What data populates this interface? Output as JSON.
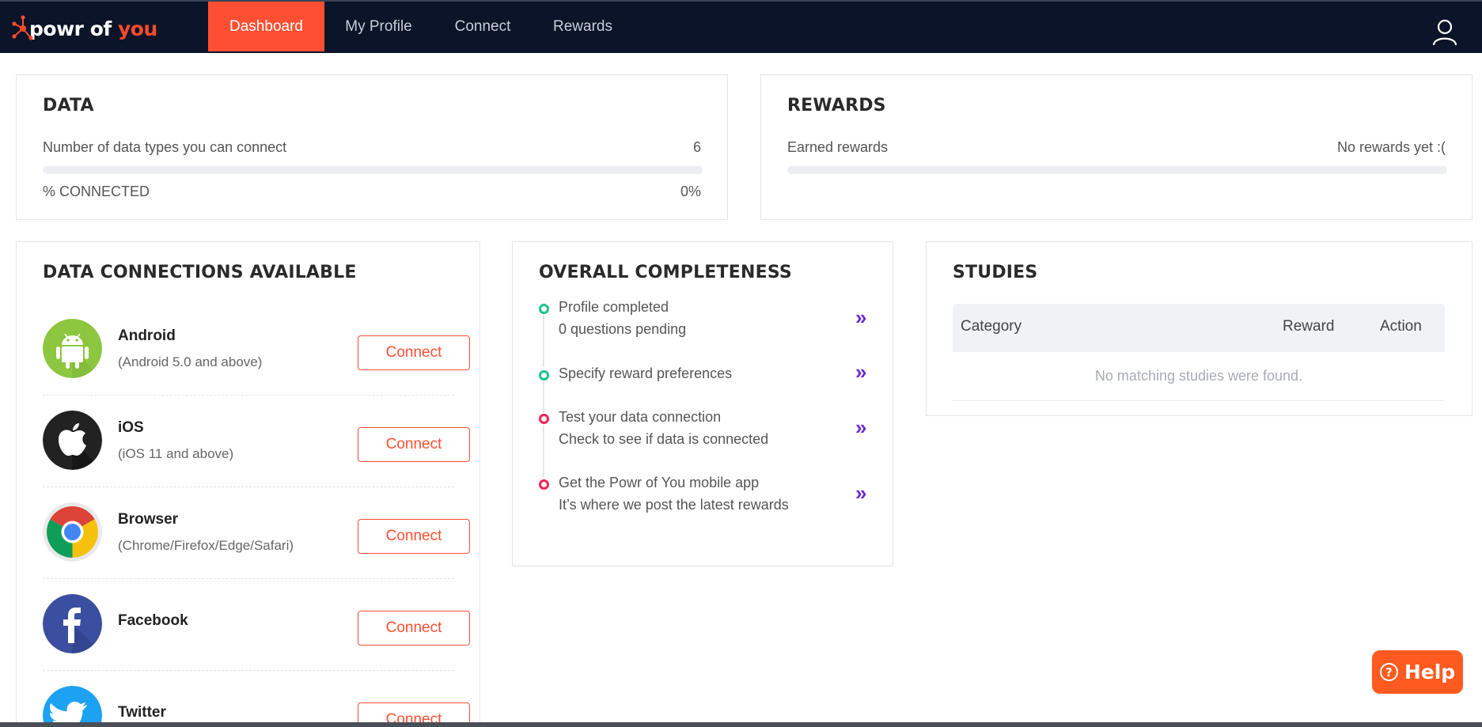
{
  "app": {
    "logo_part1": "powr of",
    "logo_part2": "you"
  },
  "nav": {
    "items": [
      {
        "label": "Dashboard",
        "active": true
      },
      {
        "label": "My Profile"
      },
      {
        "label": "Connect"
      },
      {
        "label": "Rewards"
      }
    ],
    "user_icon": "user-icon"
  },
  "data_card": {
    "title": "DATA",
    "types_label": "Number of data types you can connect",
    "types_value": "6",
    "connected_label": "% CONNECTED",
    "connected_value": "0%",
    "connected_fraction": 0
  },
  "rewards_card": {
    "title": "REWARDS",
    "earned_label": "Earned rewards",
    "earned_value": "No rewards yet :(",
    "earned_fraction": 0
  },
  "connections": {
    "title": "DATA CONNECTIONS AVAILABLE",
    "items": [
      {
        "name": "Android",
        "sub": "(Android 5.0 and above)",
        "button": "Connect",
        "icon": "android-icon"
      },
      {
        "name": "iOS",
        "sub": "(iOS 11 and above)",
        "button": "Connect",
        "icon": "apple-icon"
      },
      {
        "name": "Browser",
        "sub": "(Chrome/Firefox/Edge/Safari)",
        "button": "Connect",
        "icon": "chrome-icon"
      },
      {
        "name": "Facebook",
        "sub": "",
        "button": "Connect",
        "icon": "facebook-icon"
      },
      {
        "name": "Twitter",
        "sub": "",
        "button": "Connect",
        "icon": "twitter-icon"
      }
    ]
  },
  "completeness": {
    "title": "OVERALL COMPLETENESS",
    "steps": [
      {
        "line1": "Profile completed",
        "line2": "0 questions pending",
        "status": "done"
      },
      {
        "line1": "Specify reward preferences",
        "line2": "",
        "status": "done"
      },
      {
        "line1": "Test your data connection",
        "line2": "Check to see if data is connected",
        "status": "todo"
      },
      {
        "line1": "Get the Powr of You mobile app",
        "line2": "It’s where we post the latest rewards",
        "status": "todo"
      }
    ],
    "arrow": "»"
  },
  "studies": {
    "title": "STUDIES",
    "columns": [
      "Category",
      "Reward",
      "Action"
    ],
    "empty_text": "No matching studies were found."
  },
  "help": {
    "label": "Help",
    "icon_glyph": "?"
  },
  "colors": {
    "navbar": "#0b1428",
    "accent": "#ff4f33",
    "done": "#22c08a",
    "todo": "#ee2452",
    "arrow": "#6a2bd6",
    "help": "#ff5a1f"
  }
}
